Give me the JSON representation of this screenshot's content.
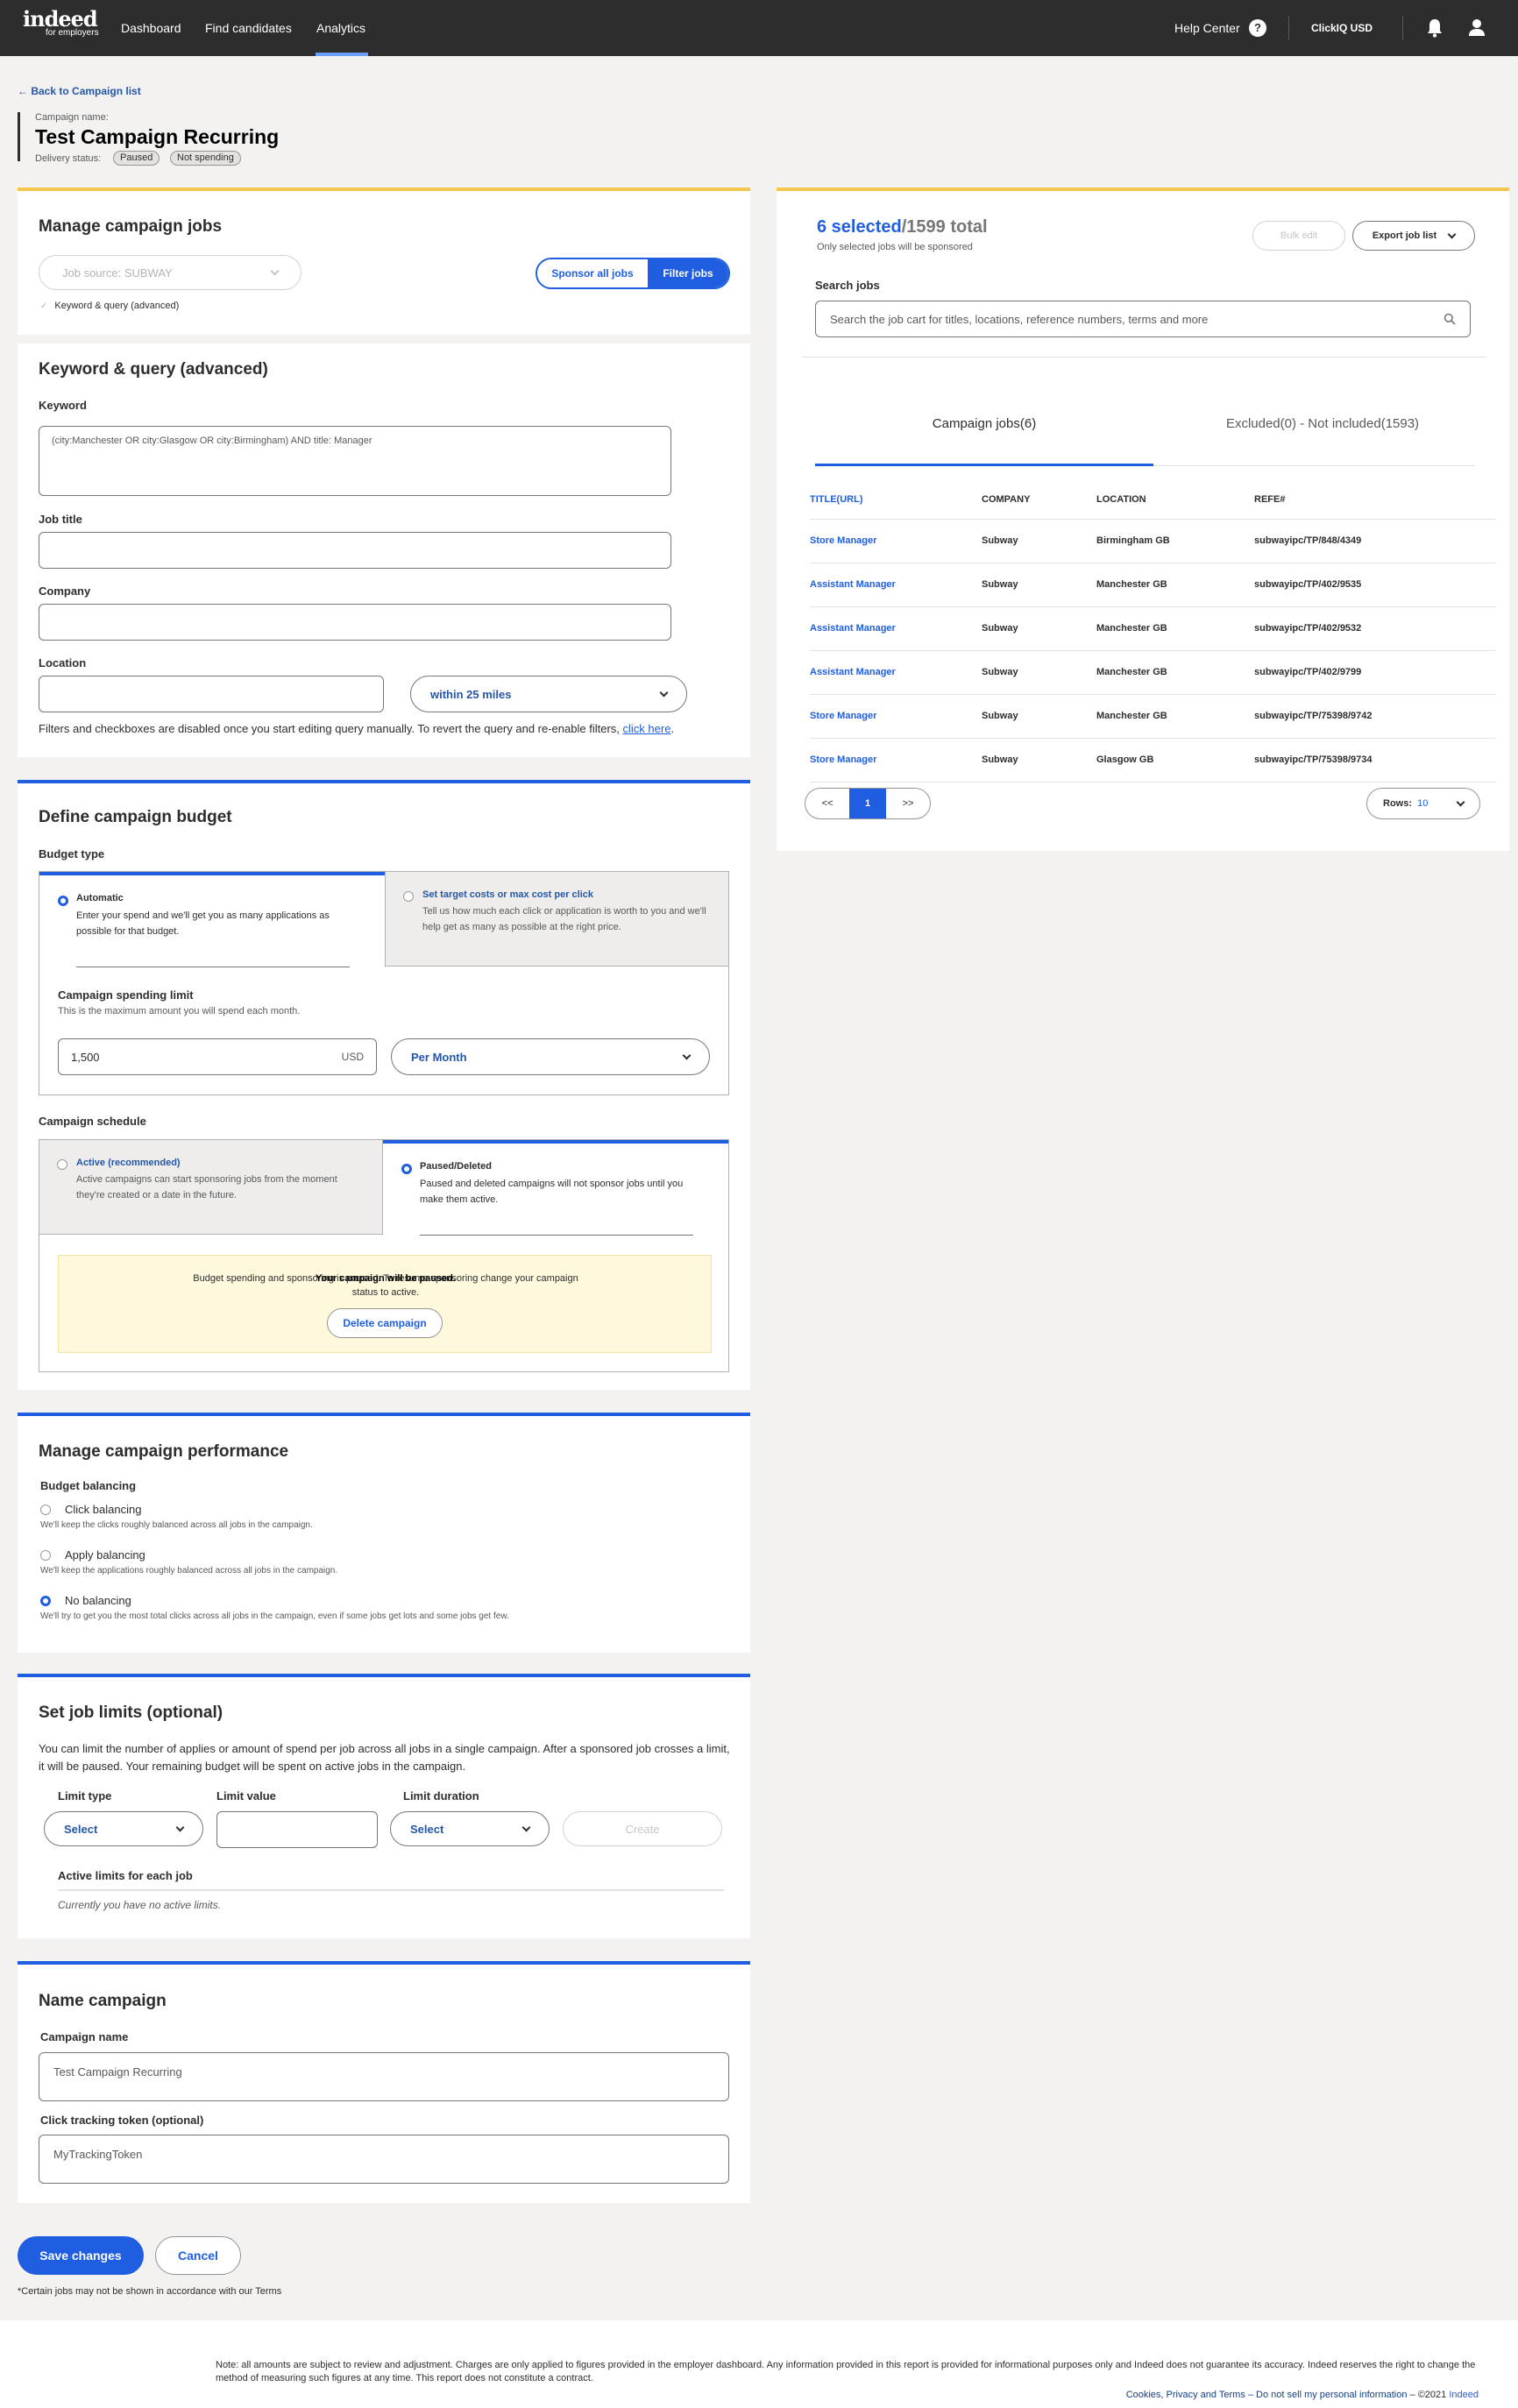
{
  "nav": {
    "logo_main": "indeed",
    "logo_sub": "for employers",
    "items": [
      "Dashboard",
      "Find candidates",
      "Analytics"
    ],
    "help": "Help Center",
    "account": "ClickIQ USD"
  },
  "header": {
    "back": "Back to Campaign list",
    "name_label": "Campaign name:",
    "title": "Test Campaign Recurring",
    "delivery_label": "Delivery status:",
    "badges": [
      "Paused",
      "Not spending"
    ]
  },
  "manage_jobs": {
    "title": "Manage campaign jobs",
    "source_placeholder": "Job source:  SUBWAY",
    "sponsor_all": "Sponsor all jobs",
    "filter_jobs": "Filter jobs",
    "checkbox_label": "Keyword & query (advanced)"
  },
  "keyword": {
    "title": "Keyword & query (advanced)",
    "keyword_label": "Keyword",
    "keyword_value": "(city:Manchester OR city:Glasgow OR city:Birmingham) AND title: Manager",
    "job_title_label": "Job title",
    "company_label": "Company",
    "location_label": "Location",
    "radius": "within 25 miles",
    "note": "Filters and checkboxes are disabled once you start editing query manually. To revert the query and re-enable filters,",
    "note_link": "click here",
    "note_end": "."
  },
  "budget": {
    "title": "Define campaign budget",
    "type_label": "Budget type",
    "auto_title": "Automatic",
    "auto_desc": "Enter your spend and we'll get you as many applications as possible for that budget.",
    "target_title": "Set target costs or max cost per click",
    "target_desc": "Tell us how much each click or application is worth to you and we'll help get as many as possible at the right price.",
    "limit_title": "Campaign spending limit",
    "limit_desc": "This is the maximum amount you will spend each month.",
    "amount": "1,500",
    "currency": "USD",
    "period": "Per Month",
    "schedule_label": "Campaign schedule",
    "active_title": "Active (recommended)",
    "active_desc": "Active campaigns can start sponsoring jobs from the moment they're created or a date in the future.",
    "paused_title": "Paused/Deleted",
    "paused_desc": "Paused and deleted campaigns will not sponsor jobs until you make them active.",
    "notice_line1": "Budget spending and sponsoring is paused. To resume sponsoring change your campaign",
    "notice_overlay": "Your campaign will be paused.",
    "notice_line2": "status to active.",
    "delete_button": "Delete campaign"
  },
  "performance": {
    "title": "Manage campaign performance",
    "balancing_label": "Budget balancing",
    "options": [
      {
        "label": "Click balancing",
        "desc": "We'll keep the clicks roughly balanced across all jobs in the campaign.",
        "selected": false
      },
      {
        "label": "Apply balancing",
        "desc": "We'll keep the applications roughly balanced across all jobs in the campaign.",
        "selected": false
      },
      {
        "label": "No balancing",
        "desc": "We'll try to get you the most total clicks across all jobs in the campaign, even if some jobs get lots and some jobs get few.",
        "selected": true
      }
    ]
  },
  "limits": {
    "title": "Set job limits (optional)",
    "desc": "You can limit the number of applies or amount of spend per job across all jobs in a single campaign. After a sponsored job crosses a limit, it will be paused. Your remaining budget will be spent on active jobs in the campaign.",
    "type_label": "Limit type",
    "value_label": "Limit value",
    "duration_label": "Limit duration",
    "type_select": "Select",
    "duration_select": "Select",
    "create": "Create",
    "active_label": "Active limits for each job",
    "empty": "Currently you have no active limits."
  },
  "name_campaign": {
    "title": "Name campaign",
    "name_label": "Campaign name",
    "name_value": "Test Campaign Recurring",
    "token_label": "Click tracking token (optional)",
    "token_value": "MyTrackingToken"
  },
  "actions": {
    "save": "Save changes",
    "cancel": "Cancel",
    "disclaimer": "*Certain jobs may not be shown in accordance with our Terms"
  },
  "jobs_panel": {
    "selected": "6 selected",
    "total": "/1599 total",
    "sub": "Only selected jobs will be sponsored",
    "bulk_edit": "Bulk edit",
    "export": "Export job list",
    "search_label": "Search jobs",
    "search_placeholder": "Search the job cart for titles, locations, reference numbers, terms and more",
    "tab_jobs": "Campaign jobs(6)",
    "tab_excluded": "Excluded(0) - Not included(1593)",
    "columns": [
      "TITLE(URL)",
      "COMPANY",
      "LOCATION",
      "REFE#"
    ],
    "rows": [
      [
        "Store Manager",
        "Subway",
        "Birmingham GB",
        "subwayipc/TP/848/4349"
      ],
      [
        "Assistant Manager",
        "Subway",
        "Manchester GB",
        "subwayipc/TP/402/9535"
      ],
      [
        "Assistant Manager",
        "Subway",
        "Manchester GB",
        "subwayipc/TP/402/9532"
      ],
      [
        "Assistant Manager",
        "Subway",
        "Manchester GB",
        "subwayipc/TP/402/9799"
      ],
      [
        "Store Manager",
        "Subway",
        "Manchester GB",
        "subwayipc/TP/75398/9742"
      ],
      [
        "Store Manager",
        "Subway",
        "Glasgow GB",
        "subwayipc/TP/75398/9734"
      ]
    ],
    "pager_prev": "<<",
    "pager_page": "1",
    "pager_next": ">>",
    "rows_label": "Rows:",
    "rows_value": "10"
  },
  "footer": {
    "note": "Note: all amounts are subject to review and adjustment. Charges are only applied to figures provided in the employer dashboard. Any information provided in this report is provided for informational purposes only and Indeed does not guarantee its accuracy. Indeed reserves the right to change the method of measuring such figures at any time. This report does not constitute a contract.",
    "links": "Cookies, Privacy and Terms – Do not sell my personal information",
    "copyright": "– ©2021",
    "brand": "Indeed"
  }
}
